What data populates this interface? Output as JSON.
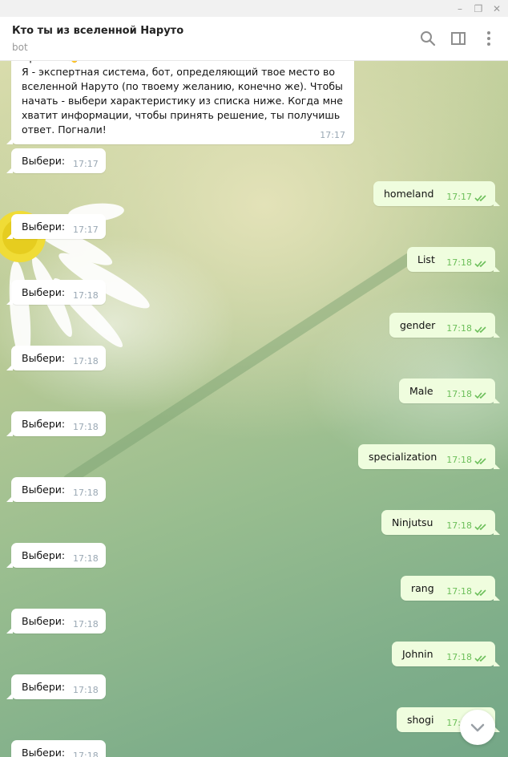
{
  "window": {
    "minimize_glyph": "–",
    "maximize_glyph": "❐",
    "close_glyph": "✕"
  },
  "header": {
    "title": "Кто ты из вселенной Наруто",
    "subtitle": "bot",
    "icons": [
      "search-icon",
      "sidebar-toggle-icon",
      "more-vertical-icon"
    ]
  },
  "messages": {
    "intro": {
      "text": "Привет! 👋\n Я - экспертная система, бот, определяющий твое место во вселенной Наруто (по твоему желанию, конечно же). Чтобы начать - выбери характеристику из списка ниже. Когда мне хватит информации, чтобы принять решение, ты получишь ответ. Погнали!",
      "time": "17:17"
    },
    "incoming": [
      {
        "text": "Выбери:",
        "time": "17:17"
      },
      {
        "text": "Выбери:",
        "time": "17:17"
      },
      {
        "text": "Выбери:",
        "time": "17:18"
      },
      {
        "text": "Выбери:",
        "time": "17:18"
      },
      {
        "text": "Выбери:",
        "time": "17:18"
      },
      {
        "text": "Выбери:",
        "time": "17:18"
      },
      {
        "text": "Выбери:",
        "time": "17:18"
      },
      {
        "text": "Выбери:",
        "time": "17:18"
      },
      {
        "text": "Выбери:",
        "time": "17:18"
      },
      {
        "text": "Выбери:",
        "time": "17:18"
      }
    ],
    "outgoing": [
      {
        "text": "homeland",
        "time": "17:17"
      },
      {
        "text": "List",
        "time": "17:18"
      },
      {
        "text": "gender",
        "time": "17:18"
      },
      {
        "text": "Male",
        "time": "17:18"
      },
      {
        "text": "specialization",
        "time": "17:18"
      },
      {
        "text": "Ninjutsu",
        "time": "17:18"
      },
      {
        "text": "rang",
        "time": "17:18"
      },
      {
        "text": "Johnin",
        "time": "17:18"
      },
      {
        "text": "shogi",
        "time": "17:18"
      }
    ]
  },
  "colors": {
    "outgoing_bubble": "#effdde",
    "incoming_bubble": "#ffffff",
    "read_check": "#6cbf5a"
  }
}
